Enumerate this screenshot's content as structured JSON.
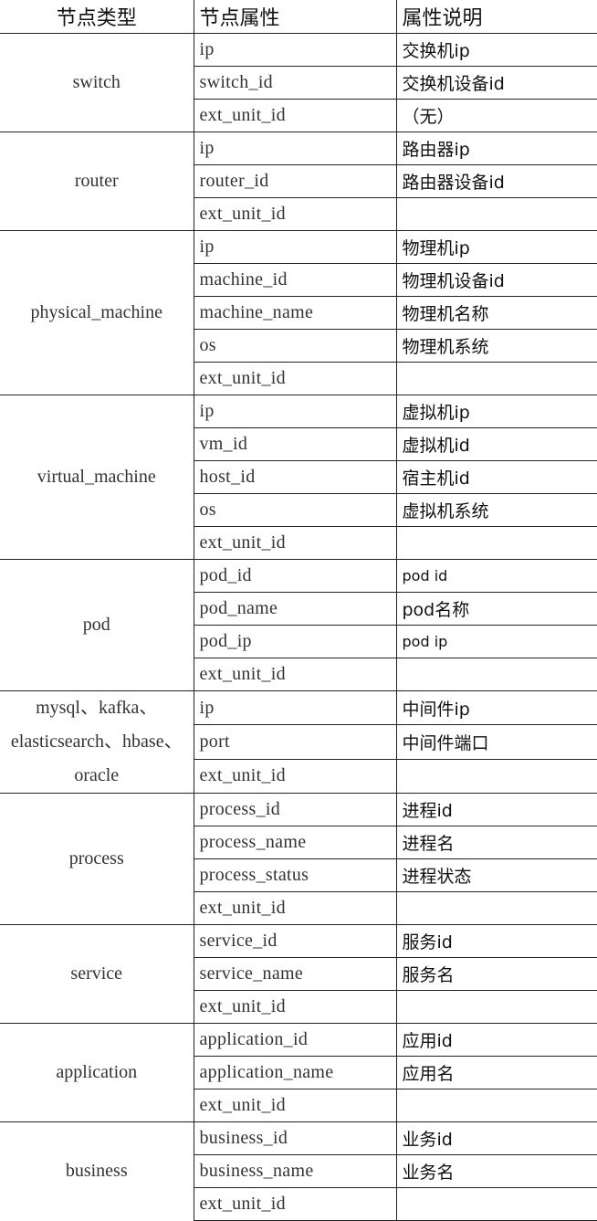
{
  "headers": [
    "节点类型",
    "节点属性",
    "属性说明"
  ],
  "groups": [
    {
      "type": "switch",
      "rows": [
        [
          "ip",
          "交换机ip"
        ],
        [
          "switch_id",
          "交换机设备id"
        ],
        [
          "ext_unit_id",
          "（无）"
        ]
      ]
    },
    {
      "type": "router",
      "rows": [
        [
          "ip",
          "路由器ip"
        ],
        [
          "router_id",
          "路由器设备id"
        ],
        [
          "ext_unit_id",
          ""
        ]
      ]
    },
    {
      "type": "physical_machine",
      "rows": [
        [
          "ip",
          "物理机ip"
        ],
        [
          "machine_id",
          "物理机设备id"
        ],
        [
          "machine_name",
          "物理机名称"
        ],
        [
          "os",
          "物理机系统"
        ],
        [
          "ext_unit_id",
          ""
        ]
      ]
    },
    {
      "type": "virtual_machine",
      "rows": [
        [
          "ip",
          "虚拟机ip"
        ],
        [
          "vm_id",
          "虚拟机id"
        ],
        [
          "host_id",
          "宿主机id"
        ],
        [
          "os",
          "虚拟机系统"
        ],
        [
          "ext_unit_id",
          ""
        ]
      ]
    },
    {
      "type": "pod",
      "rows": [
        [
          "pod_id",
          "pod id"
        ],
        [
          "pod_name",
          "pod名称"
        ],
        [
          "pod_ip",
          "pod ip"
        ],
        [
          "ext_unit_id",
          ""
        ]
      ]
    },
    {
      "type": "mysql、kafka、elasticsearch、hbase、oracle",
      "rows": [
        [
          "ip",
          "中间件ip"
        ],
        [
          "port",
          "中间件端口"
        ],
        [
          "ext_unit_id",
          ""
        ]
      ]
    },
    {
      "type": "process",
      "rows": [
        [
          "process_id",
          "进程id"
        ],
        [
          "process_name",
          "进程名"
        ],
        [
          "process_status",
          "进程状态"
        ],
        [
          "ext_unit_id",
          ""
        ]
      ]
    },
    {
      "type": "service",
      "rows": [
        [
          "service_id",
          "服务id"
        ],
        [
          "service_name",
          "服务名"
        ],
        [
          "ext_unit_id",
          ""
        ]
      ]
    },
    {
      "type": "application",
      "rows": [
        [
          "application_id",
          "应用id"
        ],
        [
          "application_name",
          "应用名"
        ],
        [
          "ext_unit_id",
          ""
        ]
      ]
    },
    {
      "type": "business",
      "rows": [
        [
          "business_id",
          "业务id"
        ],
        [
          "business_name",
          "业务名"
        ],
        [
          "ext_unit_id",
          ""
        ]
      ]
    }
  ]
}
